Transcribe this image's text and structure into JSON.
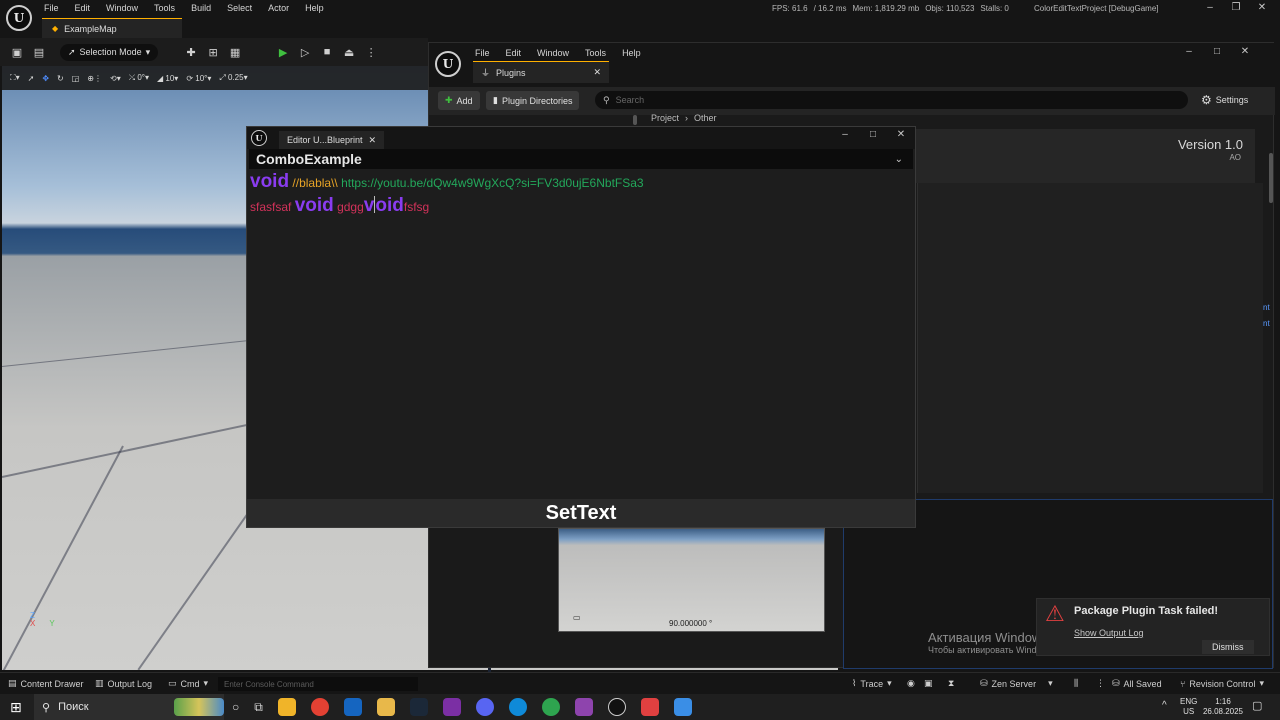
{
  "main": {
    "menu": [
      "File",
      "Edit",
      "Window",
      "Tools",
      "Build",
      "Select",
      "Actor",
      "Help"
    ],
    "map_tab": "ExampleMap",
    "stats": {
      "fps": "FPS: 61.6",
      "ms": "/ 16.2 ms",
      "mem": "Mem: 1,819.29 mb",
      "objs": "Objs: 110,523",
      "stalls": "Stalls: 0"
    },
    "project": "ColorEditTextProject [DebugGame]"
  },
  "toolbar": {
    "mode": "Selection Mode"
  },
  "viewport": {
    "snap1": "0°",
    "snap2": "10",
    "snap3": "10°",
    "snap4": "0.25"
  },
  "plugins": {
    "menu": [
      "File",
      "Edit",
      "Window",
      "Tools",
      "Help"
    ],
    "tab": "Plugins",
    "add": "Add",
    "dirs": "Plugin Directories",
    "search_placeholder": "Search",
    "settings": "Settings",
    "breadcrumb": [
      "Project",
      "Other"
    ],
    "version": "Version 1.0",
    "version_sub": "AO",
    "side_chars": [
      "nt",
      "nt"
    ]
  },
  "eub": {
    "tab": "Editor U...Blueprint",
    "combo": "ComboExample",
    "line1": {
      "kw": "void",
      "comment": " //blabla\\\\ ",
      "url": "https://youtu.be/dQw4w9WgXcQ?si=FV3d0ujE6NbtFSa3"
    },
    "line2": {
      "a": "sfasfsaf ",
      "kw1": "void",
      "b": " gdgg",
      "kw2a": "v",
      "kw2b": "oid",
      "c": "fsfsg"
    },
    "button": "SetText"
  },
  "preview": {
    "value": "90.000000 °"
  },
  "toast": {
    "title": "Package Plugin Task failed!",
    "link": "Show Output Log",
    "dismiss": "Dismiss"
  },
  "watermark": {
    "title": "Активация Windows",
    "sub": "Чтобы активировать Windows, перейдите в раздел \"Параметры\"."
  },
  "status": {
    "drawer": "Content Drawer",
    "outlog": "Output Log",
    "cmd": "Cmd",
    "console_placeholder": "Enter Console Command",
    "trace": "Trace",
    "zen": "Zen Server",
    "saved": "All Saved",
    "revision": "Revision Control"
  },
  "taskbar": {
    "search": "Поиск",
    "lang": "ENG",
    "region": "US",
    "time": "1:16",
    "date": "26.08.2025"
  },
  "colors": {
    "keyword": "#8a3cf0",
    "comment": "#e6a326",
    "url": "#23a85b",
    "plain": "#d2325a",
    "accent": "#ffb000"
  }
}
